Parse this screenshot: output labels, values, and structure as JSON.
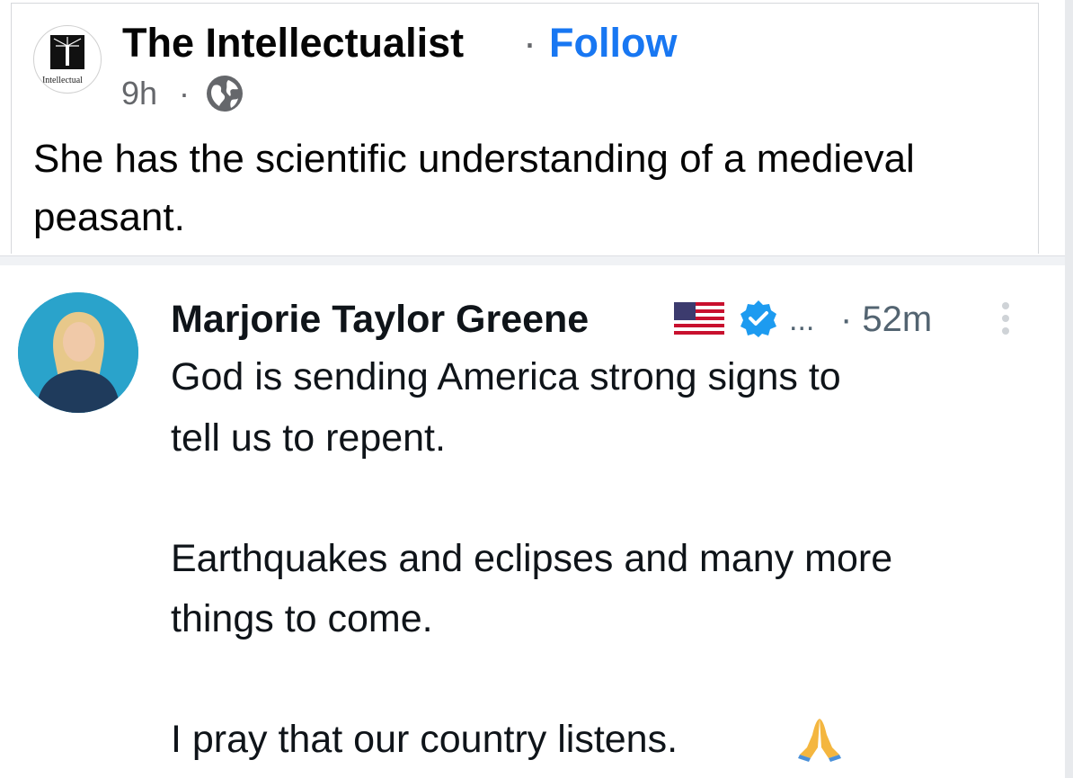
{
  "facebook_post": {
    "page_name": "The Intellectualist",
    "separator": "·",
    "follow_label": "Follow",
    "time": "9h",
    "time_separator": "·",
    "avatar_text": "e Intellectual",
    "caption": "She has the scientific understanding of a medieval peasant.",
    "audience_icon": "globe-icon"
  },
  "tweet": {
    "author_name": "Marjorie Taylor Greene",
    "ellipsis": "...",
    "time": "· 52m",
    "icons": [
      "us-flag-icon",
      "verified-badge-icon",
      "more-options-icon",
      "praying-hands-icon"
    ],
    "lines": [
      "God is sending America strong signs to",
      "tell us to repent.",
      "Earthquakes and eclipses and many more",
      "things to come.",
      "I pray that our country listens."
    ]
  },
  "colors": {
    "follow_blue": "#1877f2",
    "verified_blue": "#1d9bf0",
    "text_primary": "#050505",
    "text_secondary": "#65676b"
  }
}
